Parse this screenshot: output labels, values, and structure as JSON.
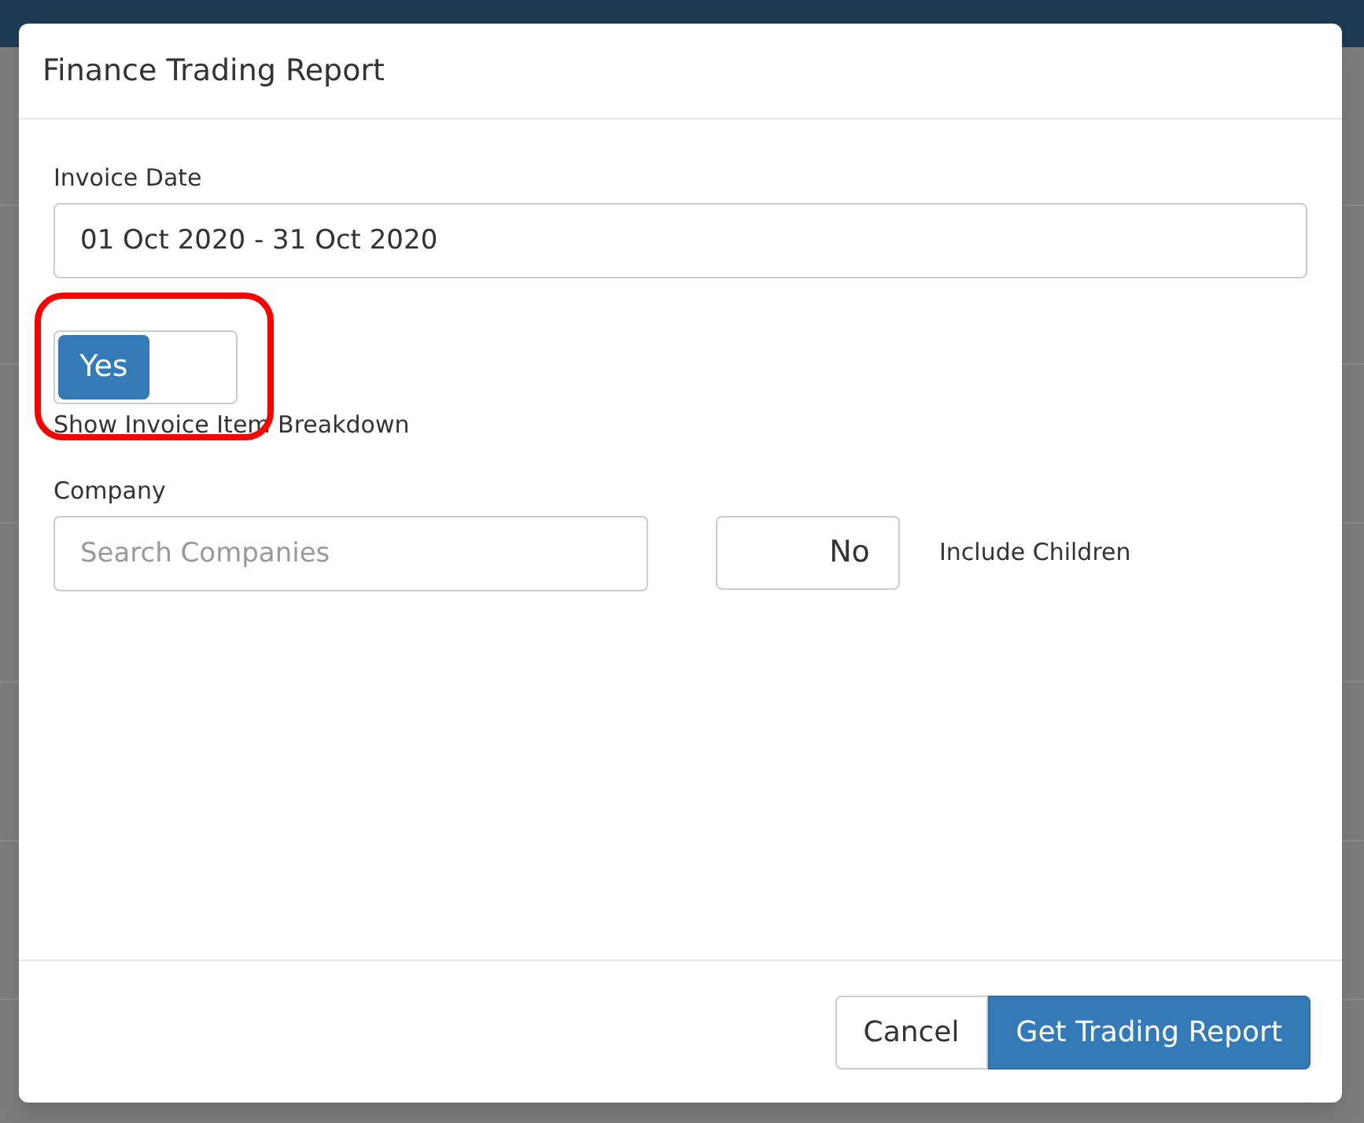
{
  "dialog": {
    "title": "Finance Trading Report",
    "invoice_date": {
      "label": "Invoice Date",
      "value": "01 Oct 2020 - 31 Oct 2020"
    },
    "breakdown_toggle": {
      "label": "Yes",
      "on": true,
      "caption": "Show Invoice Item Breakdown",
      "highlighted": true
    },
    "company": {
      "label": "Company",
      "placeholder": "Search Companies"
    },
    "children_toggle": {
      "label": "No",
      "on": false,
      "caption": "Include Children"
    },
    "buttons": [
      {
        "label": "Cancel",
        "kind": "secondary"
      },
      {
        "label": "Get Trading Report",
        "kind": "primary"
      }
    ]
  }
}
